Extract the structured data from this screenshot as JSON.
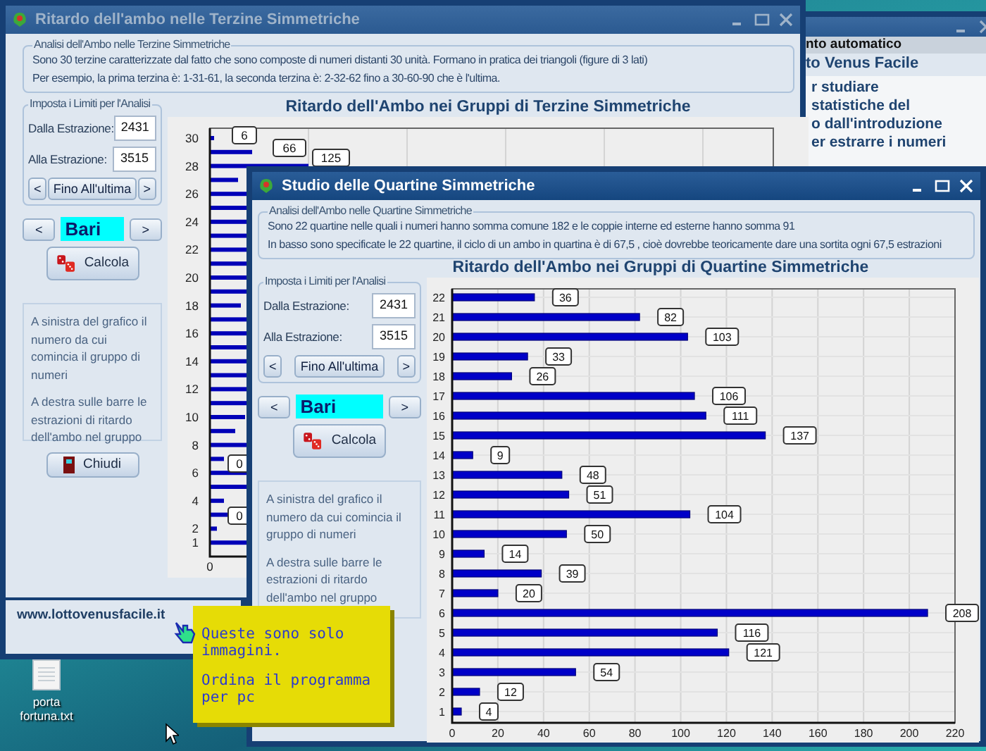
{
  "back_window": {
    "subtitle": "nto automatico",
    "heading": "to Venus Facile",
    "lines": [
      "r studiare",
      "statistiche del",
      "o dall'introduzione",
      "er estrarre i numeri"
    ]
  },
  "terzine_window": {
    "title": "Ritardo dell'ambo nelle Terzine Simmetriche",
    "active": false,
    "analysis": {
      "legend": "Analisi dell'Ambo nelle Terzine Simmetriche",
      "lines": [
        "Sono 30 terzine caratterizzate dal fatto che sono composte di numeri distanti 30 unità. Formano in pratica dei triangoli (figure di 3 lati)",
        "Per esempio, la prima terzina è: 1-31-61, la seconda terzina è: 2-32-62 fino a 30-60-90 che è l'ultima."
      ]
    },
    "limits": {
      "legend": "Imposta i Limiti per l'Analisi",
      "from_label": "Dalla Estrazione:",
      "from_value": "2431",
      "to_label": "Alla Estrazione:",
      "to_value": "3515",
      "prev": "<",
      "last_button": "Fino All'ultima",
      "next": ">"
    },
    "wheel": {
      "prev": "<",
      "value": "Bari",
      "next": ">"
    },
    "calculate_button": "Calcola",
    "info": [
      "A sinistra del grafico il numero da cui comincia il gruppo di numeri",
      "A destra sulle barre le estrazioni di ritardo dell'ambo nel gruppo"
    ],
    "close_button": "Chiudi",
    "chart": {
      "title": "Ritardo dell'Ambo nei Gruppi di Terzine Simmetriche",
      "y_tick_labels": [
        "30",
        "28",
        "26",
        "24",
        "22",
        "20",
        "18",
        "16",
        "14",
        "12",
        "10",
        "8",
        "6",
        "4",
        "2",
        "1"
      ],
      "x_tick_labels": [
        "0"
      ],
      "bar_labels": [
        "6",
        "66",
        "125",
        "0",
        "0"
      ]
    },
    "website": "www.lottovenusfacile.it"
  },
  "quartine_window": {
    "title": "Studio delle Quartine Simmetriche",
    "active": true,
    "analysis": {
      "legend": "Analisi dell'Ambo nelle Quartine Simmetriche",
      "lines": [
        "Sono 22 quartine nelle quali i numeri hanno somma comune 182 e le coppie interne ed esterne hanno somma 91",
        "In basso sono specificate le 22 quartine, il ciclo di un ambo in quartina è di 67,5 , cioè dovrebbe teoricamente dare una sortita ogni 67,5 estrazioni"
      ]
    },
    "limits": {
      "legend": "Imposta i Limiti per l'Analisi",
      "from_label": "Dalla Estrazione:",
      "from_value": "2431",
      "to_label": "Alla Estrazione:",
      "to_value": "3515",
      "prev": "<",
      "last_button": "Fino All'ultima",
      "next": ">"
    },
    "wheel": {
      "prev": "<",
      "value": "Bari",
      "next": ">"
    },
    "calculate_button": "Calcola",
    "info": [
      "A sinistra del grafico il numero da cui comincia il gruppo di numeri",
      "A destra sulle barre le estrazioni di ritardo dell'ambo nel gruppo"
    ],
    "chart_data": {
      "type": "bar",
      "orientation": "horizontal",
      "title": "Ritardo dell'Ambo nei Gruppi di Quartine Simmetriche",
      "categories": [
        "22",
        "21",
        "20",
        "19",
        "18",
        "17",
        "16",
        "15",
        "14",
        "13",
        "12",
        "11",
        "10",
        "9",
        "8",
        "7",
        "6",
        "5",
        "4",
        "3",
        "2",
        "1"
      ],
      "values": [
        36,
        82,
        103,
        33,
        26,
        106,
        111,
        137,
        9,
        48,
        51,
        104,
        50,
        14,
        39,
        20,
        208,
        116,
        121,
        54,
        12,
        4
      ],
      "xlim": [
        0,
        220
      ],
      "xticks": [
        0,
        20,
        40,
        60,
        80,
        100,
        120,
        140,
        160,
        180,
        200,
        220
      ],
      "grid": true,
      "data_labels": true
    }
  },
  "note": {
    "lines": [
      "Queste sono solo immagini.",
      "Ordina il programma per pc"
    ]
  },
  "desktop": {
    "file_label": "porta fortuna.txt"
  }
}
